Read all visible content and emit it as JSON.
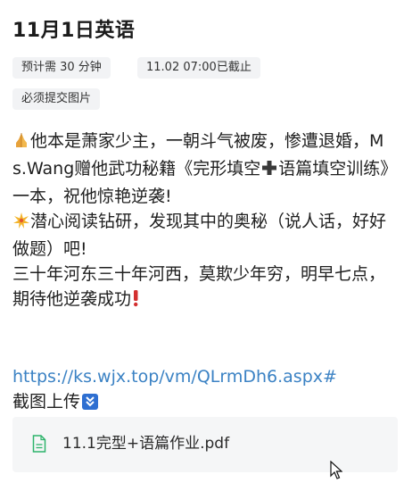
{
  "title": "11月1日英语",
  "tags": {
    "duration": "预计需 30 分钟",
    "deadline": "11.02 07:00已截止",
    "requirement": "必须提交图片"
  },
  "content": {
    "line1": "他本是萧家少主，一朝斗气被废，惨遭退婚，Ms.Wang赠他武功秘籍《完形填空",
    "line1_tail": "语篇填空训练》一本，祝他惊艳逆袭!",
    "line2": "潜心阅读钻研，发现其中的奥秘（说人话，好好做题）吧!",
    "line3": "三十年河东三十年河西，莫欺少年穷，明早七点，期待他逆袭成功",
    "link": "https://ks.wjx.top/vm/QLrmDh6.aspx#",
    "upload_text": "截图上传"
  },
  "attachment": {
    "file_name": "11.1完型+语篇作业.pdf"
  },
  "icons": {
    "pray": "folded-hands-emoji",
    "plus": "heavy-plus-emoji",
    "sparkle": "sparkle-star-emoji",
    "exclamation": "red-exclamation-emoji",
    "down": "down-arrow-button-emoji",
    "file": "document-icon",
    "cursor": "mouse-pointer"
  },
  "colors": {
    "link": "#3b82c4",
    "tag_bg": "#f2f3f5",
    "attachment_bg": "#f5f6f7",
    "file_icon": "#2db36b",
    "down_box": "#2e6fd1"
  }
}
